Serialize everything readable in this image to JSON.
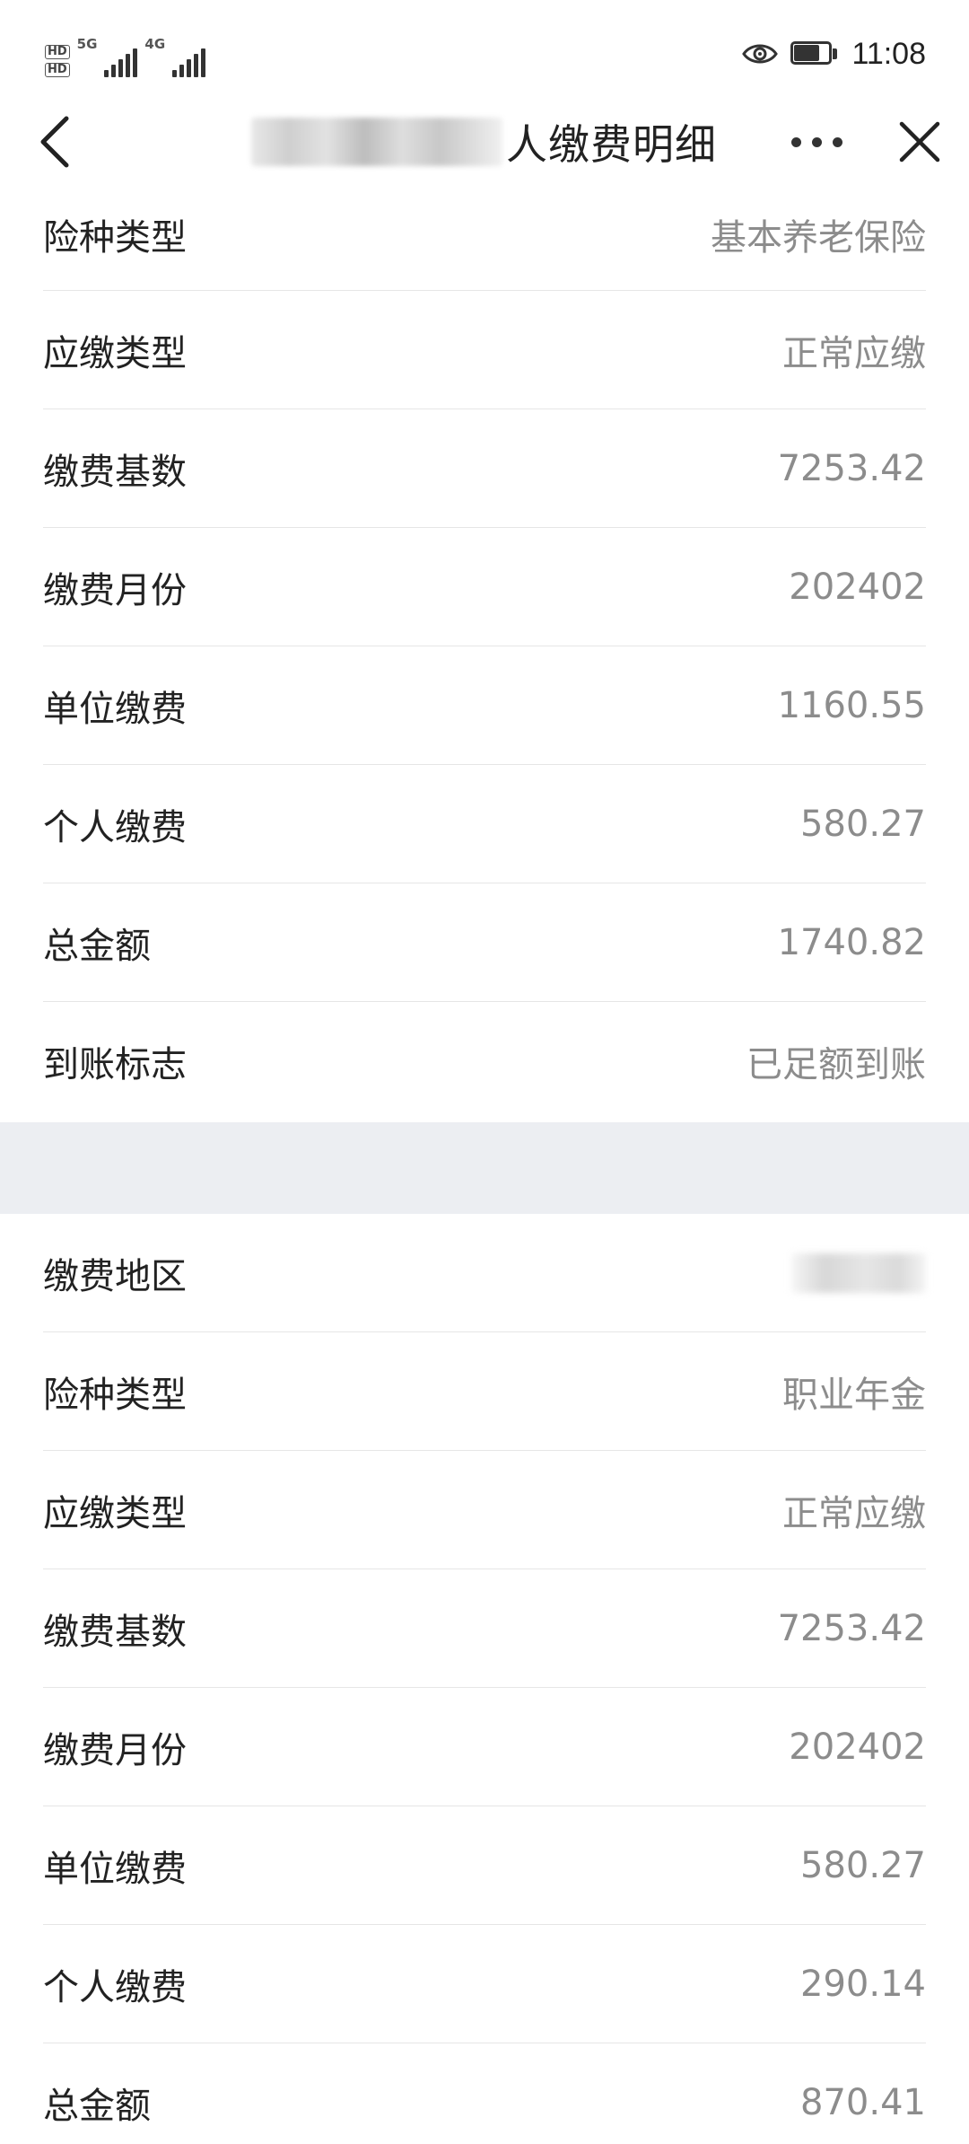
{
  "status_bar": {
    "hd_badges": [
      "HD",
      "HD"
    ],
    "network_labels": [
      "5G",
      "4G"
    ],
    "time": "11:08"
  },
  "nav": {
    "title": "人缴费明细"
  },
  "section_1": [
    {
      "label": "险种类型",
      "value": "基本养老保险"
    },
    {
      "label": "应缴类型",
      "value": "正常应缴"
    },
    {
      "label": "缴费基数",
      "value": "7253.42"
    },
    {
      "label": "缴费月份",
      "value": "202402"
    },
    {
      "label": "单位缴费",
      "value": "1160.55"
    },
    {
      "label": "个人缴费",
      "value": "580.27"
    },
    {
      "label": "总金额",
      "value": "1740.82"
    },
    {
      "label": "到账标志",
      "value": "已足额到账"
    }
  ],
  "section_2": [
    {
      "label": "缴费地区",
      "value": ""
    },
    {
      "label": "险种类型",
      "value": "职业年金"
    },
    {
      "label": "应缴类型",
      "value": "正常应缴"
    },
    {
      "label": "缴费基数",
      "value": "7253.42"
    },
    {
      "label": "缴费月份",
      "value": "202402"
    },
    {
      "label": "单位缴费",
      "value": "580.27"
    },
    {
      "label": "个人缴费",
      "value": "290.14"
    },
    {
      "label": "总金额",
      "value": "870.41"
    }
  ]
}
